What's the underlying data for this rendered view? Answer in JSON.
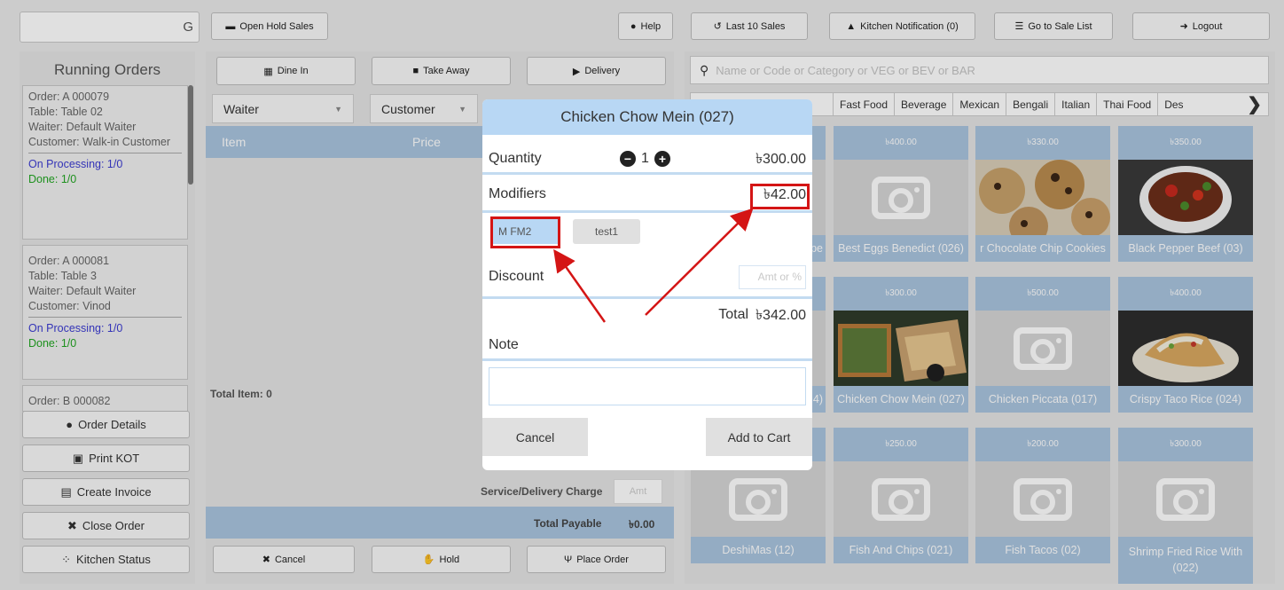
{
  "topbar": {
    "search_value": "G",
    "open_hold": "Open Hold Sales",
    "help": "Help",
    "last_sales": "Last 10 Sales",
    "kitchen_notif": "Kitchen Notification (0)",
    "sale_list": "Go to Sale List",
    "logout": "Logout"
  },
  "running": {
    "title": "Running Orders",
    "orders": [
      {
        "order": "Order: A 000079",
        "table": "Table: Table 02",
        "waiter": "Waiter: Default Waiter",
        "customer": "Customer: Walk-in Customer",
        "processing": "On Processing: 1/0",
        "done": "Done: 1/0"
      },
      {
        "order": "Order: A 000081",
        "table": "Table: Table 3",
        "waiter": "Waiter: Default Waiter",
        "customer": "Customer: Vinod",
        "processing": "On Processing: 1/0",
        "done": "Done: 1/0"
      },
      {
        "order": "Order: B 000082"
      }
    ],
    "buttons": {
      "details": "Order Details",
      "kot": "Print KOT",
      "invoice": "Create Invoice",
      "close": "Close Order",
      "kitchen": "Kitchen Status"
    }
  },
  "cart": {
    "dine_in": "Dine In",
    "take_away": "Take Away",
    "delivery": "Delivery",
    "waiter": "Waiter",
    "customer": "Customer",
    "col_item": "Item",
    "col_price": "Price",
    "total_item": "Total Item: 0",
    "service_charge": "Service/Delivery Charge",
    "amt": "Amt",
    "total_payable": "Total Payable",
    "payable_value": "৳0.00",
    "cancel": "Cancel",
    "hold": "Hold",
    "place": "Place Order"
  },
  "menu": {
    "search_placeholder": "Name or Code or Category or VEG or BEV or BAR",
    "tabs": [
      "Fast Food",
      "Beverage",
      "Mexican",
      "Bengali",
      "Italian",
      "Thai Food",
      "Des"
    ],
    "items": [
      {
        "price": "",
        "name": ""
      },
      {
        "price": "৳400.00",
        "name": "Best Eggs Benedict (026)"
      },
      {
        "price": "৳330.00",
        "name": "r Chocolate Chip Cookies"
      },
      {
        "price": "৳350.00",
        "name": "Black Pepper Beef (03)"
      },
      {
        "price": "",
        "name": ""
      },
      {
        "price": "৳300.00",
        "name": "Chicken Chow Mein (027)"
      },
      {
        "price": "৳500.00",
        "name": "Chicken Piccata (017)"
      },
      {
        "price": "৳400.00",
        "name": "Crispy Taco Rice (024)"
      },
      {
        "price": "",
        "name": "DeshiMas (12)"
      },
      {
        "price": "৳250.00",
        "name": "Fish And Chips (021)"
      },
      {
        "price": "৳200.00",
        "name": "Fish Tacos (02)"
      },
      {
        "price": "৳300.00",
        "name": "Shrimp Fried Rice With"
      }
    ],
    "hidden_name_1": "pe",
    "hidden_name_2": "4)",
    "partial_next": "(022)"
  },
  "modal": {
    "title": "Chicken Chow Mein (027)",
    "quantity_label": "Quantity",
    "qty": "1",
    "qty_price": "৳300.00",
    "modifiers_label": "Modifiers",
    "modifiers_price": "৳42.00",
    "modifier_1": "M FM2",
    "modifier_2": "test1",
    "discount_label": "Discount",
    "discount_placeholder": "Amt or %",
    "total_label": "Total",
    "total_value": "৳342.00",
    "note_label": "Note",
    "cancel": "Cancel",
    "add": "Add to Cart"
  },
  "colors": {
    "accent": "#b8d7f4",
    "highlight": "#d41515"
  }
}
